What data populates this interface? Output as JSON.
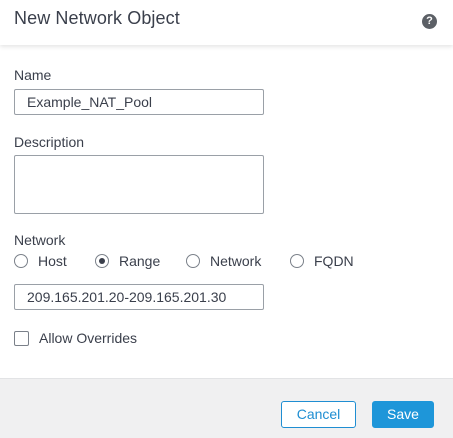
{
  "dialog": {
    "title": "New Network Object",
    "help_icon": "help-icon"
  },
  "form": {
    "name": {
      "label": "Name",
      "value": "Example_NAT_Pool"
    },
    "description": {
      "label": "Description",
      "value": ""
    },
    "network": {
      "label": "Network",
      "options": [
        {
          "label": "Host",
          "checked": false
        },
        {
          "label": "Range",
          "checked": true
        },
        {
          "label": "Network",
          "checked": false
        },
        {
          "label": "FQDN",
          "checked": false
        }
      ],
      "value": "209.165.201.20-209.165.201.30"
    },
    "allow_overrides": {
      "label": "Allow Overrides",
      "checked": false
    }
  },
  "footer": {
    "cancel_label": "Cancel",
    "save_label": "Save"
  },
  "colors": {
    "primary": "#1e96d9",
    "text": "#3a3f4b",
    "footer_bg": "#f0f0f1"
  }
}
